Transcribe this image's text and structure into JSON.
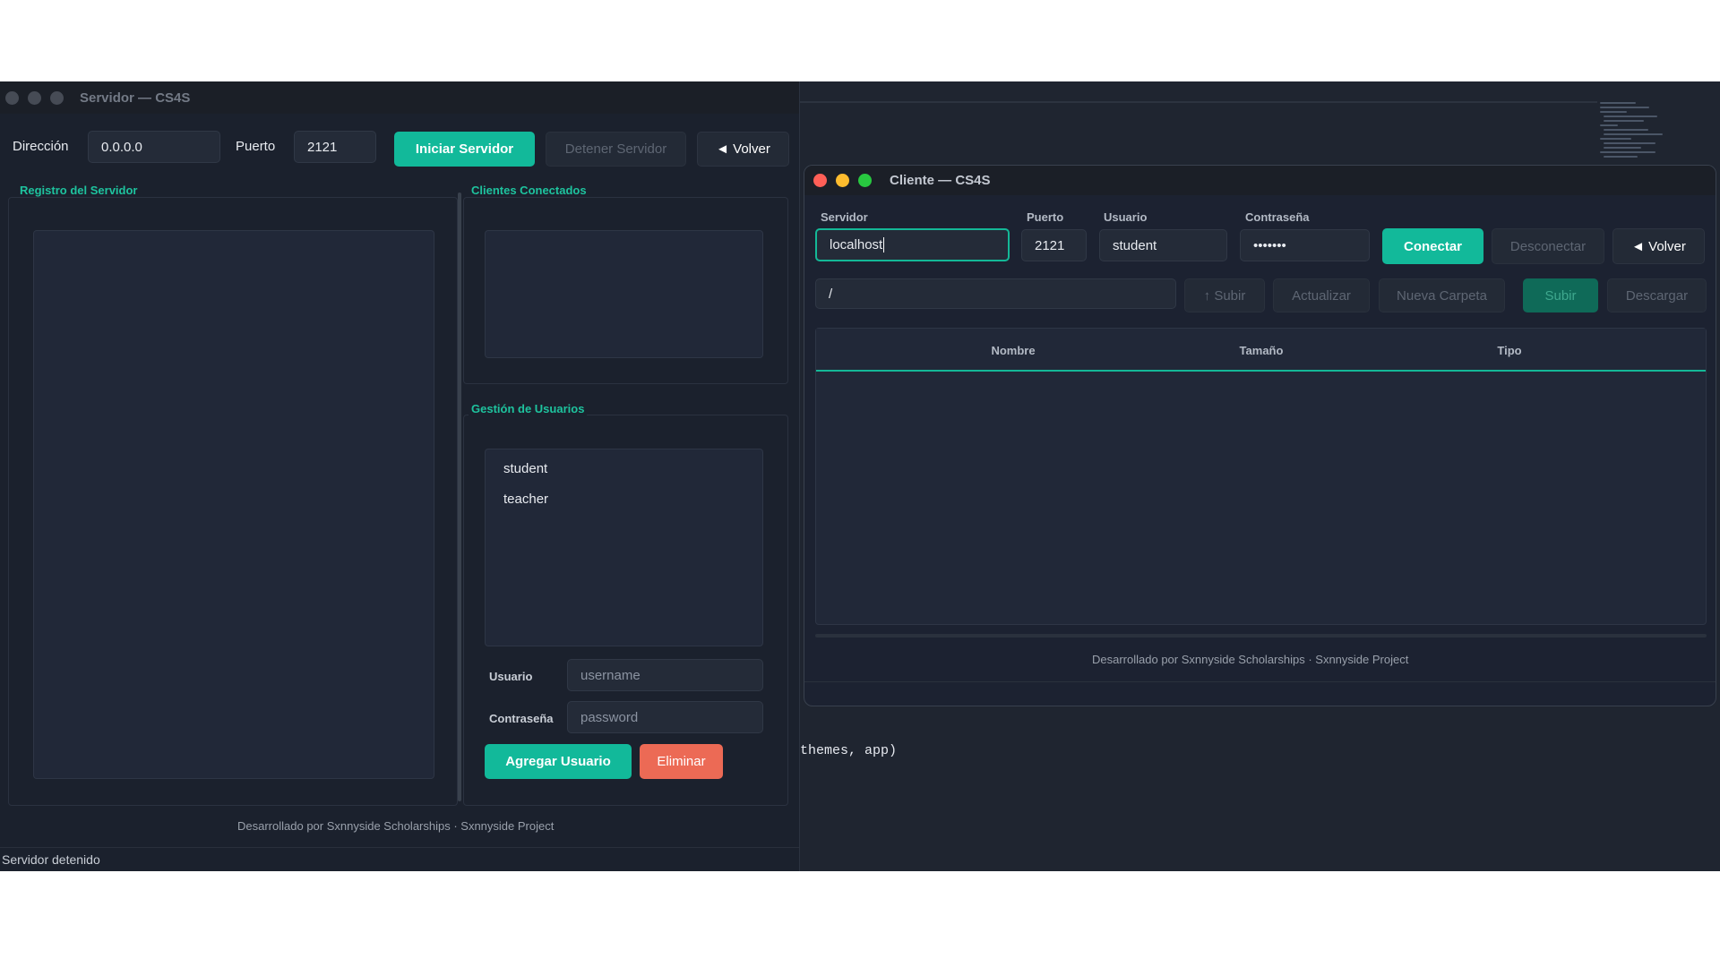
{
  "server_window": {
    "title": "Servidor — CS4S",
    "direccion_label": "Dirección",
    "direccion_value": "0.0.0.0",
    "puerto_label": "Puerto",
    "puerto_value": "2121",
    "start_label": "Iniciar Servidor",
    "stop_label": "Detener Servidor",
    "back_label": "◄  Volver",
    "log_title": "Registro del Servidor",
    "clients_title": "Clientes Conectados",
    "users_title": "Gestión de Usuarios",
    "users": [
      "student",
      "teacher"
    ],
    "usuario_label": "Usuario",
    "usuario_placeholder": "username",
    "contrasena_label": "Contraseña",
    "contrasena_placeholder": "password",
    "add_user_label": "Agregar Usuario",
    "delete_label": "Eliminar",
    "footer": "Desarrollado por Sxnnyside Scholarships · Sxnnyside Project",
    "status": "Servidor detenido"
  },
  "client_window": {
    "title": "Cliente — CS4S",
    "servidor_label": "Servidor",
    "servidor_value": "localhost",
    "puerto_label": "Puerto",
    "puerto_value": "2121",
    "usuario_label": "Usuario",
    "usuario_value": "student",
    "contrasena_label": "Contraseña",
    "contrasena_value": "•••••••",
    "connect_label": "Conectar",
    "disconnect_label": "Desconectar",
    "back_label": "◄  Volver",
    "path_value": "/",
    "up_label": "↑ Subir",
    "refresh_label": "Actualizar",
    "new_folder_label": "Nueva Carpeta",
    "upload_label": "Subir",
    "download_label": "Descargar",
    "columns": [
      "Nombre",
      "Tamaño",
      "Tipo"
    ],
    "footer": "Desarrollado por Sxnnyside Scholarships · Sxnnyside Project"
  },
  "background": {
    "code_text": "themes, app)"
  },
  "colors": {
    "accent": "#12b99a",
    "danger": "#ec6a55",
    "close": "#ff5f57",
    "minimize": "#febc2e",
    "maximize": "#28c840"
  }
}
